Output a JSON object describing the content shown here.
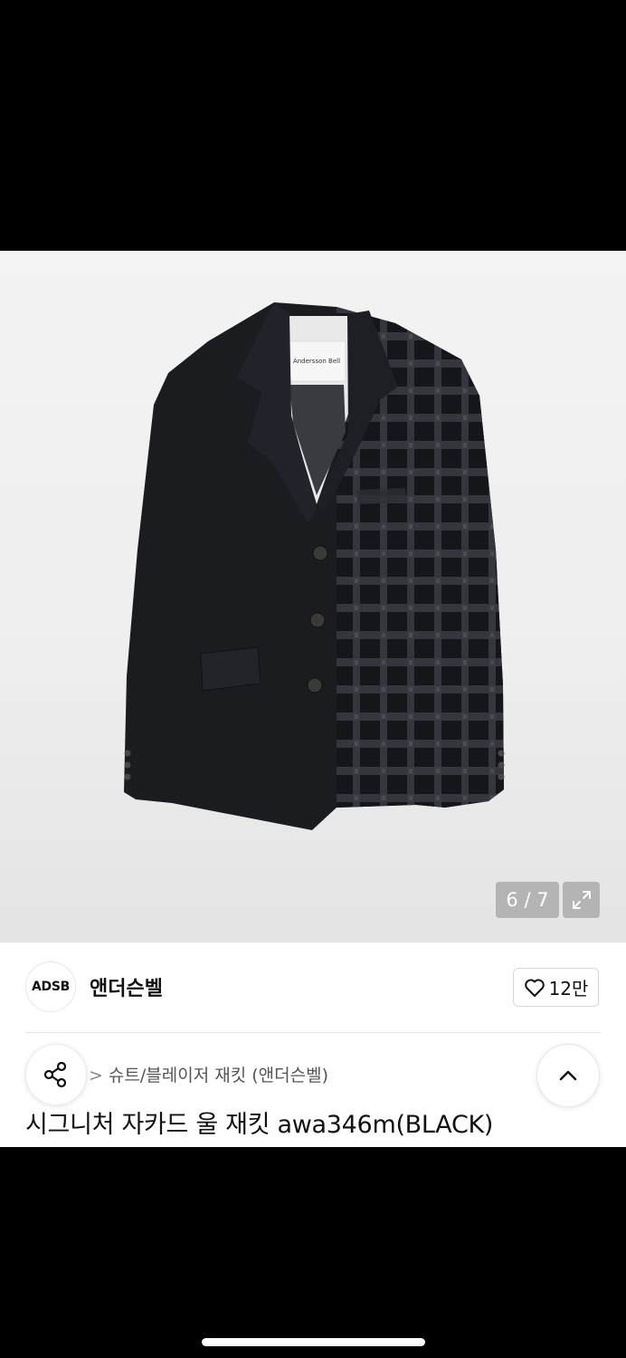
{
  "gallery": {
    "counter": "6 / 7",
    "product_tag_text": "Andersson Bell"
  },
  "brand": {
    "logo_text": "ADSB",
    "name": "앤더슨벨",
    "like_count": "12만"
  },
  "breadcrumb": {
    "separator": ">",
    "category": "슈트/블레이저 재킷 (앤더슨벨)"
  },
  "product": {
    "title": "시그니처 자카드 울 재킷 awa346m(BLACK)"
  },
  "icons": {
    "expand": "expand-icon",
    "heart": "heart-icon",
    "share": "share-icon",
    "scroll_top": "chevron-up-icon"
  },
  "colors": {
    "jacket": "#1b1c20",
    "plaid": "#3a3b42",
    "background": "#000000",
    "panel": "#ffffff"
  }
}
